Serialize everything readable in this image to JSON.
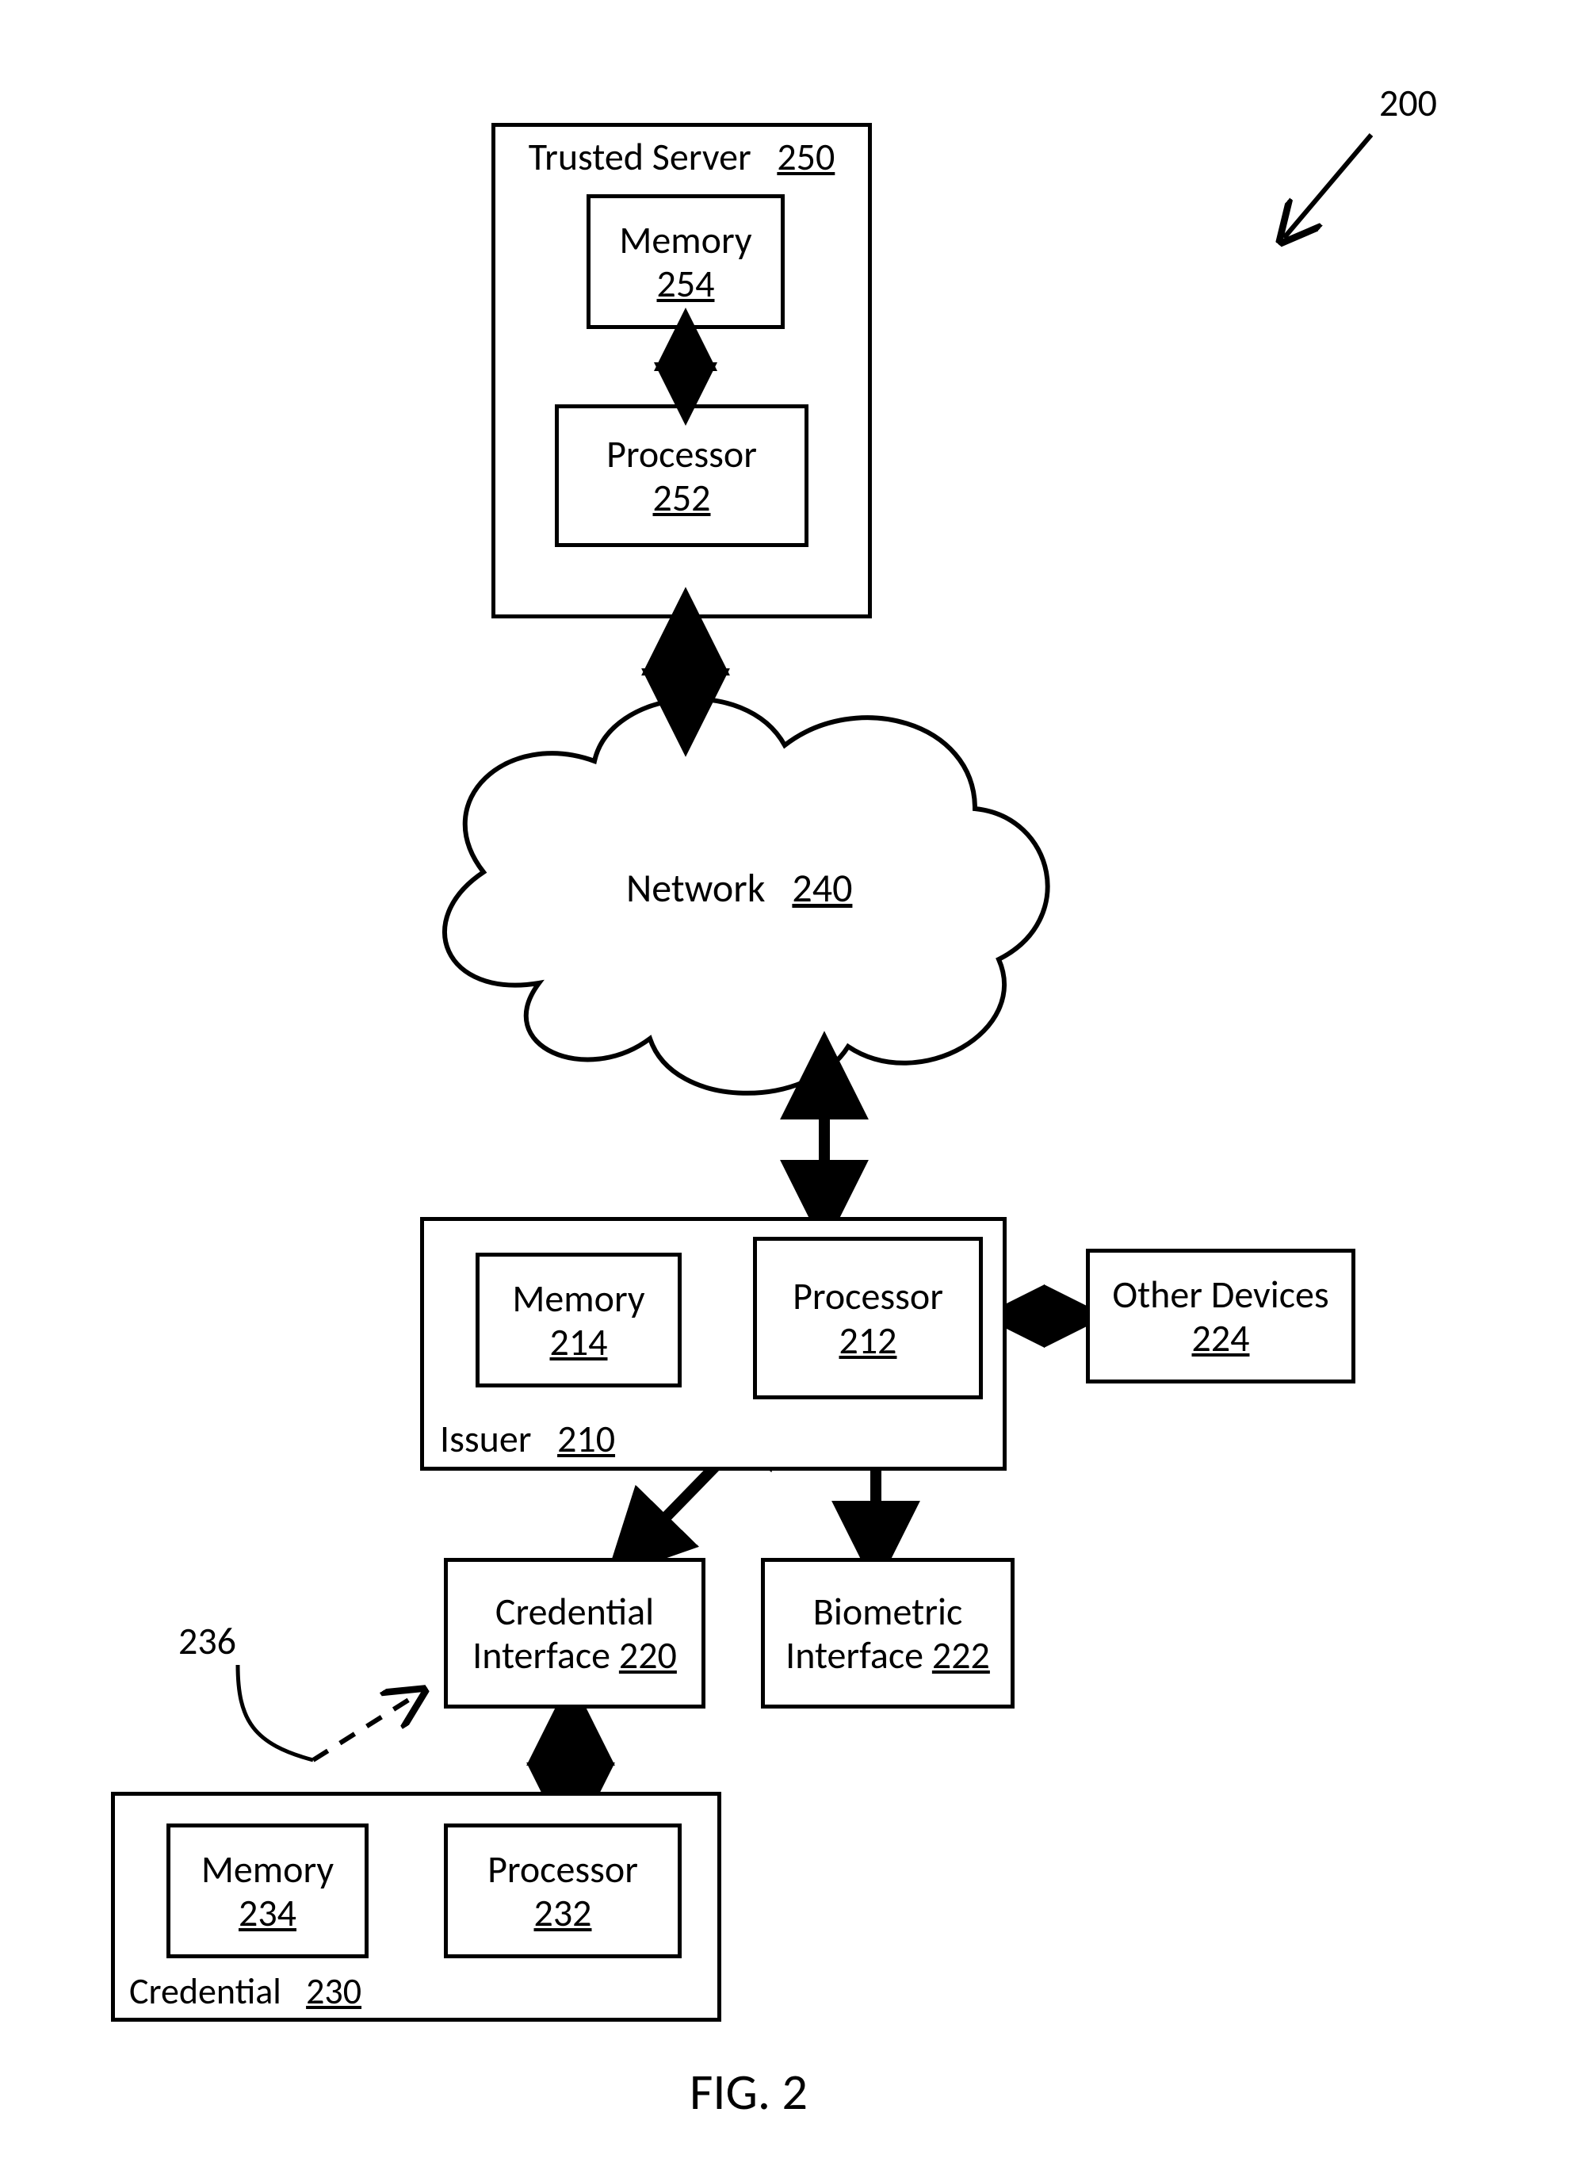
{
  "diagram": {
    "ref_number": "200",
    "figure_label": "FIG. 2",
    "trusted_server": {
      "label": "Trusted Server",
      "ref": "250"
    },
    "memory_254": {
      "label": "Memory",
      "ref": "254"
    },
    "processor_252": {
      "label": "Processor",
      "ref": "252"
    },
    "network": {
      "label": "Network",
      "ref": "240"
    },
    "issuer": {
      "label": "Issuer",
      "ref": "210"
    },
    "memory_214": {
      "label": "Memory",
      "ref": "214"
    },
    "processor_212": {
      "label": "Processor",
      "ref": "212"
    },
    "other_devices": {
      "label": "Other Devices",
      "ref": "224"
    },
    "credential_interface": {
      "label": "Credential Interface",
      "ref": "220"
    },
    "biometric_interface": {
      "label": "Biometric Interface",
      "ref": "222"
    },
    "credential": {
      "label": "Credential",
      "ref": "230"
    },
    "memory_234": {
      "label": "Memory",
      "ref": "234"
    },
    "processor_232": {
      "label": "Processor",
      "ref": "232"
    },
    "leader_236": "236"
  }
}
